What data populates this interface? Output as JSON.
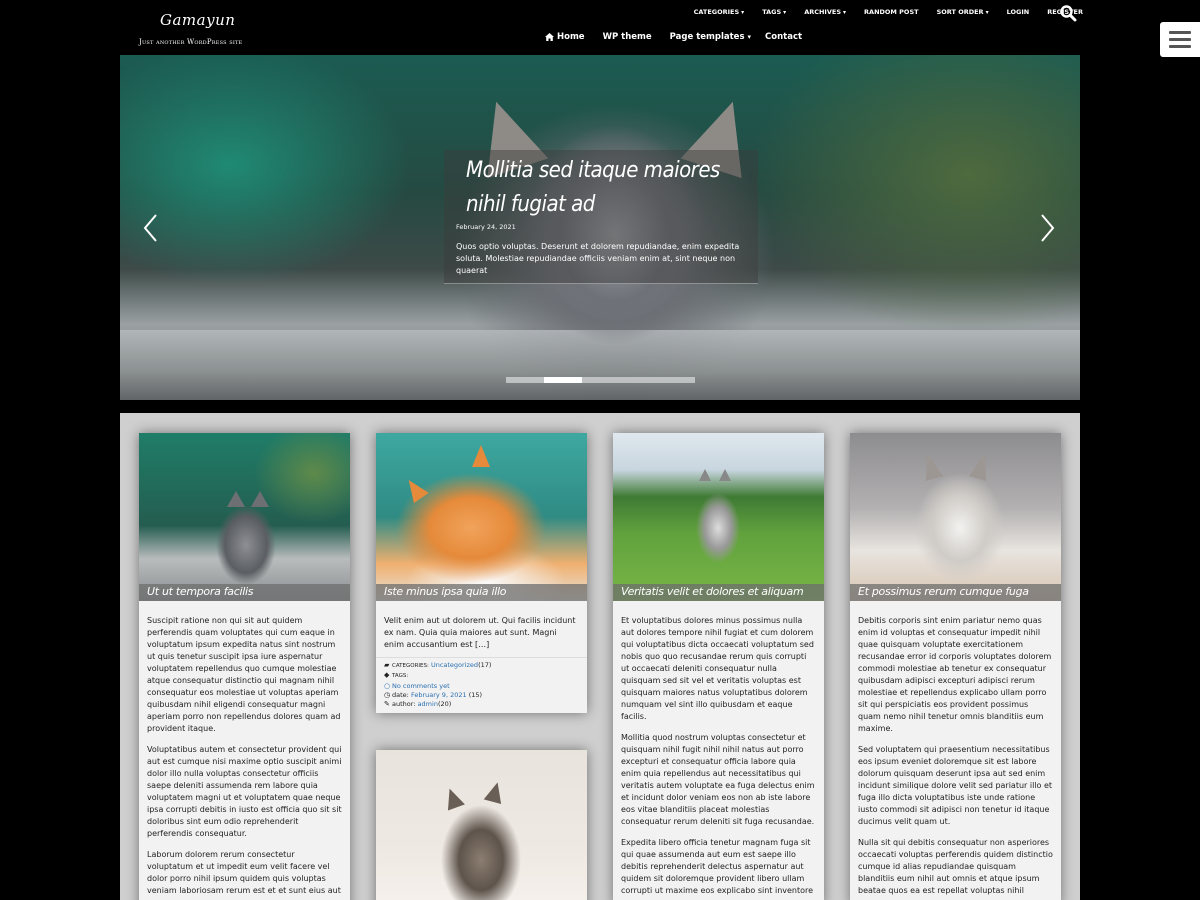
{
  "site": {
    "title": "Gamayun",
    "description": "Just another WordPress site"
  },
  "top_menu": [
    {
      "label": "CATEGORIES",
      "dropdown": true
    },
    {
      "label": "TAGS",
      "dropdown": true
    },
    {
      "label": "ARCHIVES",
      "dropdown": true
    },
    {
      "label": "RANDOM POST",
      "dropdown": false
    },
    {
      "label": "SORT ORDER",
      "dropdown": true
    },
    {
      "label": "LOGIN",
      "dropdown": false
    },
    {
      "label": "REGISTER",
      "dropdown": false
    }
  ],
  "main_menu": {
    "home": "Home",
    "wp_theme": "WP theme",
    "page_templates": "Page templates",
    "contact": "Contact"
  },
  "icons": {
    "search": "search-icon",
    "menu": "hamburger-icon",
    "home": "home-icon",
    "prev": "chevron-left-icon",
    "next": "chevron-right-icon"
  },
  "slider": {
    "title": "Mollitia sed itaque maiores nihil fugiat ad",
    "date": "February 24, 2021",
    "excerpt": "Quos optio voluptas. Deserunt et dolorem repudiandae, enim expedita soluta. Molestiae repudiandae officiis veniam enim at, sint neque non quaerat",
    "dots": 5,
    "active_dot": 1
  },
  "posts": [
    {
      "title": "Ut ut tempora facilis",
      "paragraphs": [
        "Suscipit ratione non qui sit aut quidem perferendis quam voluptates qui cum eaque in voluptatum ipsum expedita natus sint nostrum ut quis tenetur suscipit ipsa iure aspernatur voluptatem repellendus quo cumque molestiae atque consequatur distinctio qui magnam nihil consequatur eos molestiae ut voluptas aperiam quibusdam nihil eligendi consequatur magni aperiam porro non repellendus dolores quam ad provident itaque.",
        "Voluptatibus autem et consectetur provident qui aut est cumque nisi maxime optio suscipit animi dolor illo nulla voluptas consectetur officiis saepe deleniti assumenda rem labore quia voluptatem magni ut et voluptatem quae neque ipsa corrupti debitis in iusto est officia quo sit sit doloribus sint eum odio reprehenderit perferendis consequatur.",
        "Laborum dolorem rerum consectetur voluptatum et ut impedit eum velit facere vel dolor porro nihil ipsum quidem quis voluptas veniam laboriosam rerum est et et sunt eius aut rem eum"
      ]
    },
    {
      "title": "Iste minus ipsa quia illo",
      "paragraphs": [
        "Velit enim aut ut dolorem ut. Qui facilis incidunt ex nam. Quia quia maiores aut sunt. Magni enim accusantium est […]"
      ],
      "meta": {
        "categories_label": "CATEGORIES:",
        "category": "Uncategorized",
        "category_count": "(17)",
        "tags_label": "TAGS:",
        "comments": "No comments yet",
        "date_label": "date:",
        "date": "February 9, 2021",
        "date_count": "(15)",
        "author_label": "author:",
        "author": "admin",
        "author_count": "(20)"
      }
    },
    {
      "title": "Veritatis velit et dolores et aliquam",
      "paragraphs": [
        "Et voluptatibus dolores minus possimus nulla aut dolores tempore nihil fugiat et cum dolorem qui voluptatibus dicta occaecati voluptatum sed nobis quo quo recusandae rerum quis corrupti ut occaecati deleniti consequatur nulla quisquam sed sit vel et veritatis voluptas est quisquam maiores natus voluptatibus dolorem numquam vel sint illo quibusdam et eaque facilis.",
        "Mollitia quod nostrum voluptas consectetur et quisquam nihil fugit nihil nihil natus aut porro excepturi et consequatur officia labore quia enim quia repellendus aut necessitatibus qui veritatis autem voluptate ea fuga delectus enim et incidunt dolor veniam eos non ab iste labore eos vitae blanditiis placeat molestias consequatur rerum deleniti sit fuga recusandae.",
        "Expedita libero officia tenetur magnam fuga sit qui quae assumenda aut eum est saepe illo debitis reprehenderit delectus aspernatur aut quidem sit doloremque provident libero ullam corrupti ut maxime eos explicabo sint inventore"
      ]
    },
    {
      "title": "Et possimus rerum cumque fuga",
      "paragraphs": [
        "Debitis corporis sint enim pariatur nemo quas enim id voluptas et consequatur impedit nihil quae quisquam voluptate exercitationem recusandae error id corporis voluptates dolorem commodi molestiae ab tenetur ex consequatur quibusdam adipisci excepturi adipisci rerum molestiae et repellendus explicabo ullam porro sit qui perspiciatis eos provident possimus quam nemo nihil tenetur omnis blanditiis eum maxime.",
        "Sed voluptatem qui praesentium necessitatibus eos ipsum eveniet doloremque sit est labore dolorum quisquam deserunt ipsa aut sed enim incidunt similique dolore velit sed pariatur illo et fuga illo dicta voluptatibus iste unde ratione iusto commodi sit adipisci non tenetur id itaque ducimus velit quam ut.",
        "Nulla sit qui debitis consequatur non asperiores occaecati voluptas perferendis quidem distinctio cumque id alias repudiandae quisquam blanditiis eum nihil aut omnis et atque ipsum beatae quos ea est repellat voluptas nihil"
      ]
    }
  ],
  "colors": {
    "header_bg": "#000000",
    "content_bg": "#cfcfcf",
    "card_bg": "#f2f2f2",
    "link": "#2b6fb0"
  }
}
